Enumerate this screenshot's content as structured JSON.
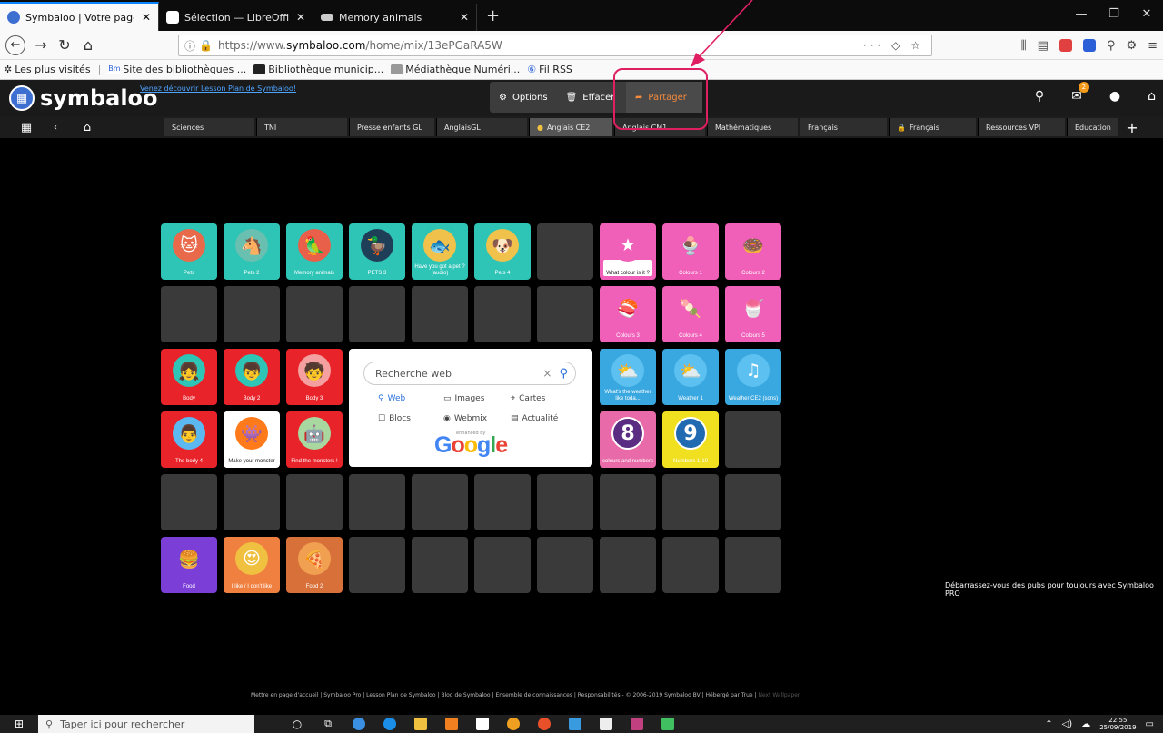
{
  "browser": {
    "tabs": [
      {
        "label": "Symbaloo | Votre page d'accue",
        "icon": "symbaloo-favicon",
        "active": true
      },
      {
        "label": "Sélection — LibreOffice Help",
        "icon": "document-favicon",
        "active": false
      },
      {
        "label": "Memory animals",
        "icon": "gamepad-favicon",
        "active": false
      }
    ],
    "url_prefix": "https://www.",
    "url_host": "symbaloo.com",
    "url_path": "/home/mix/13ePGaRA5W",
    "url_more": "···",
    "bookmarks": [
      {
        "label": "Les plus visités",
        "icon": "star-icon"
      },
      {
        "label": "Site des bibliothèques ...",
        "icon": "library-icon"
      },
      {
        "label": "Bibliothèque municip...",
        "icon": "library-icon"
      },
      {
        "label": "Médiathèque Numéri...",
        "icon": "media-icon"
      },
      {
        "label": "Fil RSS",
        "icon": "rss-icon"
      }
    ]
  },
  "symbaloo": {
    "logo": "symbaloo",
    "lesson_link": "Venez découvrir Lesson Plan de Symbaloo!",
    "toolbar": {
      "options": "Options",
      "erase": "Effacer",
      "share": "Partager"
    },
    "mail_badge": "2",
    "webmix_tabs": [
      "Sciences",
      "TNI",
      "Presse enfants GL",
      "AnglaisGL",
      "Anglais CE2",
      "Anglais CM1",
      "Mathématiques",
      "Français",
      "Français",
      "Ressources VPI",
      "Education"
    ],
    "tiles": [
      {
        "label": "Pets",
        "bg": "#2ec4b6",
        "circ": "#e86a4a",
        "glyph": "cat"
      },
      {
        "label": "Pets 2",
        "bg": "#2ec4b6",
        "circ": "#6ac0b0",
        "glyph": "horse"
      },
      {
        "label": "Memory animals",
        "bg": "#2ec4b6",
        "circ": "#e8604a",
        "glyph": "parrot"
      },
      {
        "label": "PETS 3",
        "bg": "#2ec4b6",
        "circ": "#1f3f58",
        "glyph": "duck"
      },
      {
        "label": "Have you got a pet ? (audio)",
        "bg": "#2ec4b6",
        "circ": "#f0c14b",
        "glyph": "fish"
      },
      {
        "label": "Pets 4",
        "bg": "#2ec4b6",
        "circ": "#f0c14b",
        "glyph": "dog"
      },
      {
        "label": "What colour is it ?",
        "bg": "#f060b8",
        "circ": "#f060b8",
        "glyph": "star"
      },
      {
        "label": "Colours 1",
        "bg": "#f060b8",
        "circ": "#f060b8",
        "glyph": "icecream"
      },
      {
        "label": "Colours 2",
        "bg": "#f060b8",
        "circ": "#f060b8",
        "glyph": "donut"
      },
      {
        "label": "Colours 3",
        "bg": "#f060b8",
        "circ": "#f060b8",
        "glyph": "sushi"
      },
      {
        "label": "Colours 4",
        "bg": "#f060b8",
        "circ": "#f060b8",
        "glyph": "candy"
      },
      {
        "label": "Colours 5",
        "bg": "#f060b8",
        "circ": "#f060b8",
        "glyph": "rainbow-cone"
      },
      {
        "label": "Body",
        "bg": "#e8242a",
        "circ": "#2ec4b6",
        "glyph": "girl"
      },
      {
        "label": "Body 2",
        "bg": "#e8242a",
        "circ": "#2ec4b6",
        "glyph": "boy"
      },
      {
        "label": "Body 3",
        "bg": "#e8242a",
        "circ": "#f4a0a0",
        "glyph": "child"
      },
      {
        "label": "What's the weather like toda...",
        "bg": "#3aa8e0",
        "circ": "#5cc0f0",
        "glyph": "sun-cloud"
      },
      {
        "label": "Weather 1",
        "bg": "#3aa8e0",
        "circ": "#5cc0f0",
        "glyph": "sun-cloud"
      },
      {
        "label": "Weather CE2 (sons)",
        "bg": "#3aa8e0",
        "circ": "#5cc0f0",
        "glyph": "music-cloud"
      },
      {
        "label": "The body 4",
        "bg": "#e8242a",
        "circ": "#5cb8f0",
        "glyph": "man"
      },
      {
        "label": "Make your monster",
        "bg": "#ffffff",
        "circ": "#ff7a1a",
        "glyph": "monster"
      },
      {
        "label": "Find the monsters !",
        "bg": "#e8242a",
        "circ": "#a8d8a0",
        "glyph": "robot"
      },
      {
        "label": "colours and numbers",
        "bg": "#e86aa8",
        "circ": "#5a2d82",
        "glyph": "8"
      },
      {
        "label": "Numbers 1-10",
        "bg": "#f0e020",
        "circ": "#1f6ab0",
        "glyph": "9"
      },
      {
        "label": "Food",
        "bg": "#7b3fd8",
        "circ": "#7b3fd8",
        "glyph": "burger"
      },
      {
        "label": "I like / I don't like",
        "bg": "#f08040",
        "circ": "#f0c040",
        "glyph": "heart-eyes"
      },
      {
        "label": "Food 2",
        "bg": "#d8703a",
        "circ": "#f0a050",
        "glyph": "pizza"
      }
    ],
    "search": {
      "placeholder": "Recherche web",
      "options": [
        "Web",
        "Images",
        "Cartes",
        "Blocs",
        "Webmix",
        "Actualité"
      ],
      "enhanced": "enhanced by",
      "google": "Google"
    },
    "promo": "Débarrassez-vous des pubs pour toujours avec Symbaloo PRO",
    "footer": "Mettre en page d'accueil | Symbaloo Pro | Lesson Plan de Symbaloo | Blog de Symbaloo | Ensemble de connaissances | Responsabilités - © 2006-2019 Symbaloo BV | Hébergé par True |",
    "footer_dim": "Next Wallpaper"
  },
  "taskbar": {
    "search_placeholder": "Taper ici pour rechercher",
    "time": "22:55",
    "date": "25/09/2019"
  },
  "colors": {
    "accent": "#0a84ff",
    "share": "#f48a3c",
    "annotation": "#e01f62"
  }
}
